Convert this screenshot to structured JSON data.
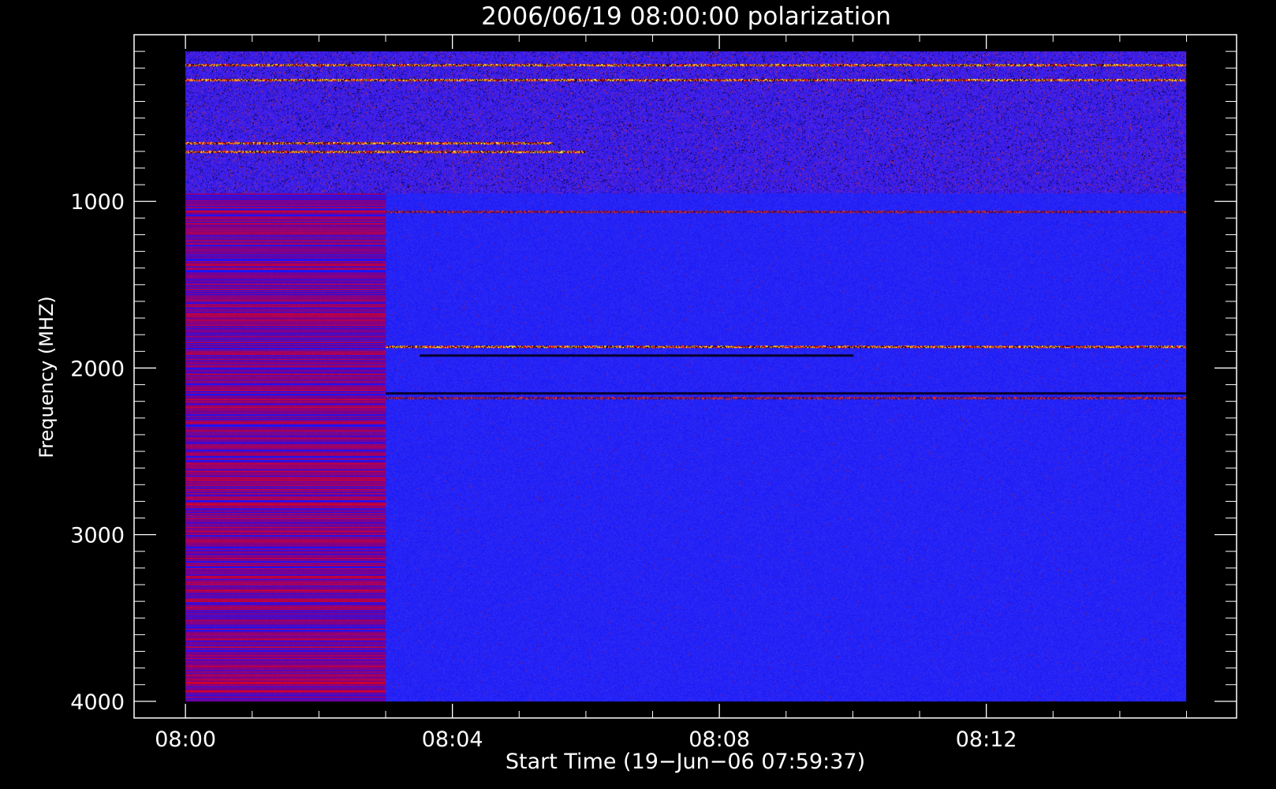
{
  "chart_data": {
    "type": "heatmap",
    "title": "2006/06/19 08:00:00 polarization",
    "xlabel": "Start Time (19−Jun−06 07:59:37)",
    "ylabel": "Frequency (MHZ)",
    "x_tick_labels": [
      "08:00",
      "08:04",
      "08:08",
      "08:12"
    ],
    "x_tick_minutes": [
      0,
      4,
      8,
      12
    ],
    "y_tick_labels": [
      "1000",
      "2000",
      "3000",
      "4000"
    ],
    "y_tick_values": [
      1000,
      2000,
      3000,
      4000
    ],
    "xlim_minutes": [
      -0.77,
      15.75
    ],
    "ylim": [
      4100,
      0
    ],
    "data_time_range_minutes": [
      0,
      15
    ],
    "data_frequency_range": [
      100,
      4000
    ],
    "instrument_change_minute": 3.0,
    "colormap": [
      "#000000",
      "#2a00a0",
      "#1a1aff",
      "#ff0000",
      "#ffa500",
      "#ffffff"
    ],
    "background_color": "#1a1aff",
    "grid": false,
    "notable_features": [
      {
        "freq": 180,
        "t0": 0,
        "t1": 15,
        "level": "high"
      },
      {
        "freq": 270,
        "t0": 0,
        "t1": 15,
        "level": "high"
      },
      {
        "freq": 650,
        "t0": 0,
        "t1": 5.5,
        "level": "high"
      },
      {
        "freq": 700,
        "t0": 0,
        "t1": 6,
        "level": "high"
      },
      {
        "freq": 1060,
        "t0": 3,
        "t1": 15,
        "level": "medium"
      },
      {
        "freq": 1870,
        "t0": 3,
        "t1": 15,
        "level": "high"
      },
      {
        "freq": 1920,
        "t0": 3.5,
        "t1": 10,
        "level": "low"
      },
      {
        "freq": 2150,
        "t0": 3,
        "t1": 15,
        "level": "low"
      },
      {
        "freq": 2180,
        "t0": 3,
        "t1": 15,
        "level": "medium"
      }
    ]
  }
}
